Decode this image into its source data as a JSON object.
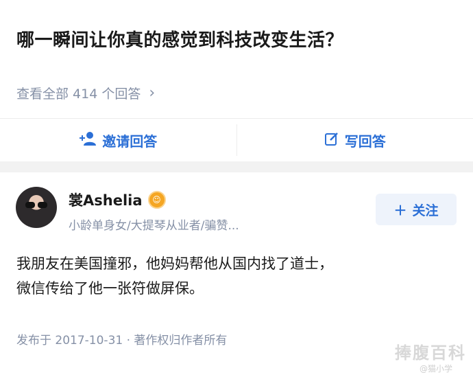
{
  "question": {
    "title": "哪一瞬间让你真的感觉到科技改变生活？"
  },
  "answers_link": {
    "label": "查看全部 414 个回答"
  },
  "actions": {
    "invite_label": "邀请回答",
    "write_label": "写回答"
  },
  "author": {
    "name": "裳Ashelia",
    "bio": "小龄单身女/大提琴从业者/骗赞..."
  },
  "follow": {
    "label": "关注"
  },
  "answer": {
    "line1": "我朋友在美国撞邪，他妈妈帮他从国内找了道士，",
    "line2": "微信传给了他一张符做屏保。"
  },
  "meta": {
    "text": "发布于 2017-10-31 · 著作权归作者所有"
  },
  "watermark": {
    "main": "捧腹百科",
    "sub": "@猫小学"
  },
  "colors": {
    "accent": "#2b6fd6",
    "muted": "#8590a6",
    "band": "#f2f2f2"
  }
}
